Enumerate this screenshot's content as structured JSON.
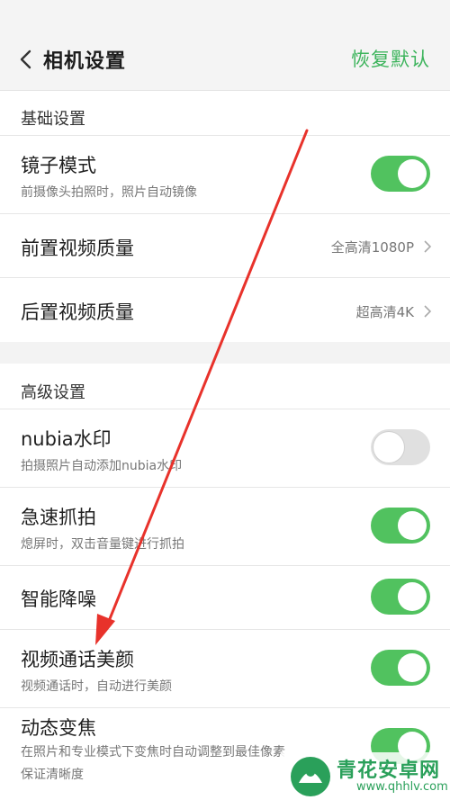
{
  "header": {
    "title": "相机设置",
    "restore_label": "恢复默认"
  },
  "sections": {
    "basic": "基础设置",
    "advanced": "高级设置"
  },
  "rows": {
    "mirror": {
      "title": "镜子模式",
      "sub": "前摄像头拍照时，照片自动镜像",
      "enabled": true
    },
    "front_video": {
      "title": "前置视频质量",
      "value": "全高清1080P"
    },
    "rear_video": {
      "title": "后置视频质量",
      "value": "超高清4K"
    },
    "nubia_watermark": {
      "title": "nubia水印",
      "sub": "拍摄照片自动添加nubia水印",
      "enabled": false
    },
    "quick_snap": {
      "title": "急速抓拍",
      "sub": "熄屏时，双击音量键进行抓拍",
      "enabled": true
    },
    "noise_reduction": {
      "title": "智能降噪",
      "enabled": true
    },
    "video_beauty": {
      "title": "视频通话美颜",
      "sub": "视频通话时，自动进行美颜",
      "enabled": true
    },
    "dynamic_zoom": {
      "title": "动态变焦",
      "sub": "在照片和专业模式下变焦时自动调整到最佳像素",
      "sub2": "保证清晰度",
      "enabled": true
    }
  },
  "colors": {
    "accent": "#3db45c",
    "toggle_on": "#51c25f",
    "toggle_off": "#e0e0e0",
    "arrow": "#e8322b"
  },
  "watermark": {
    "text": "青花安卓网",
    "url": "www.qhhlv.com"
  },
  "icons": {
    "back": "chevron-left-icon",
    "chevron": "chevron-right-icon"
  }
}
